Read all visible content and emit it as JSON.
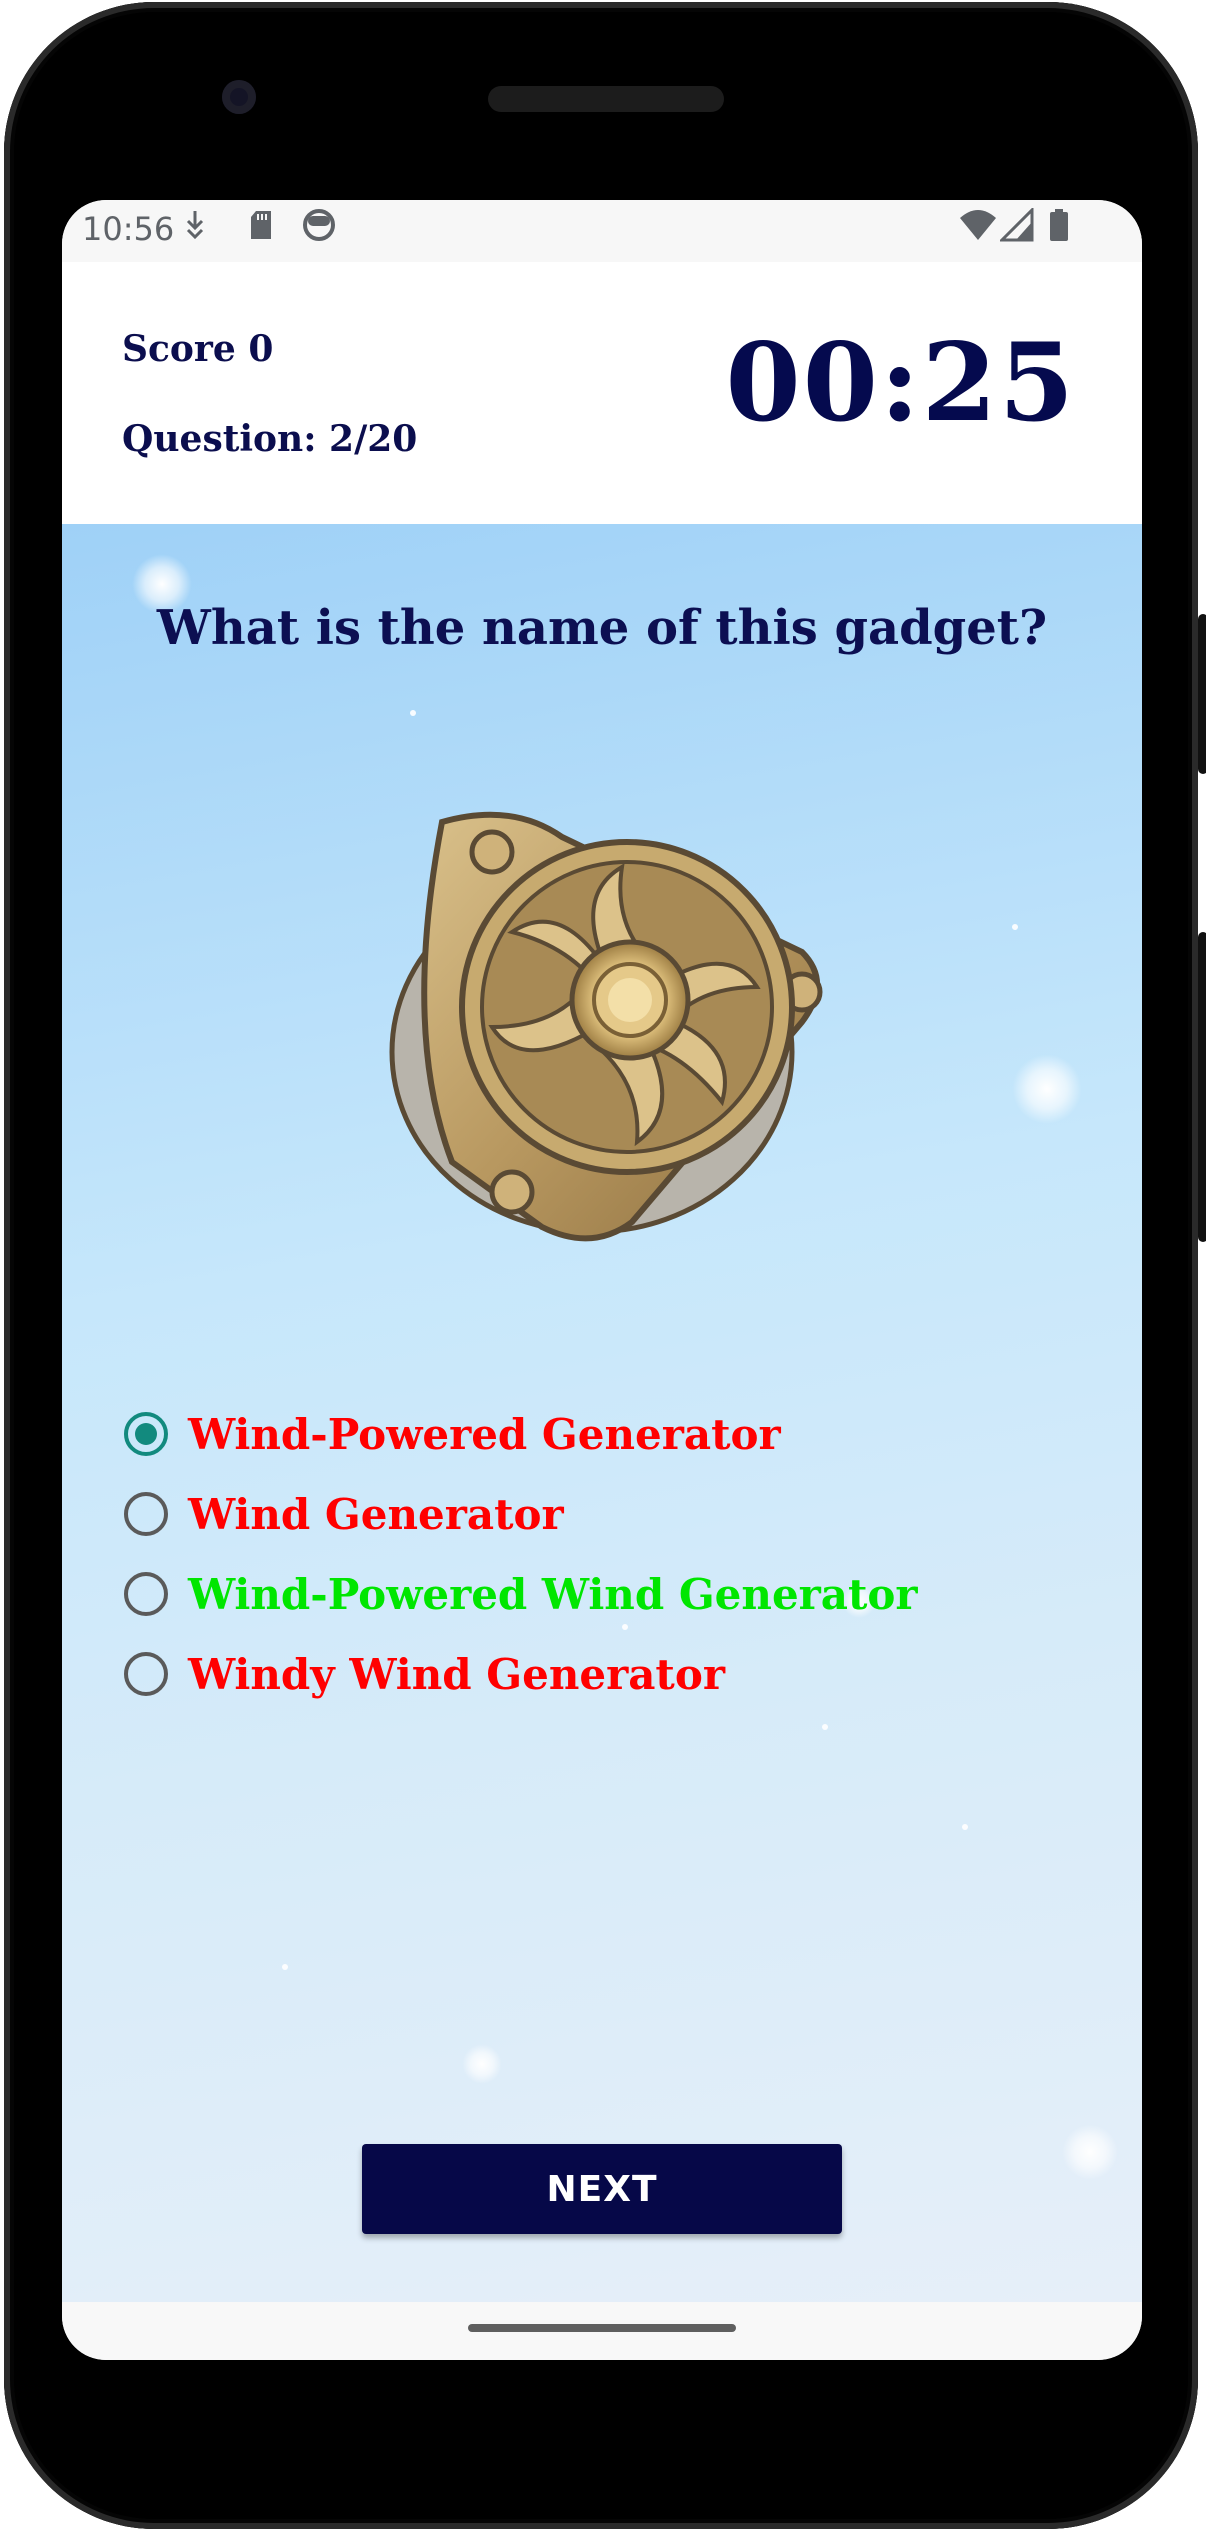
{
  "status_bar": {
    "time": "10:56",
    "icons": [
      "download-icon",
      "sd-card-icon",
      "face-icon",
      "wifi-icon",
      "signal-icon",
      "battery-icon"
    ]
  },
  "header": {
    "score_text": "Score 0",
    "question_text": "Question: 2/20",
    "timer": "00:25"
  },
  "quiz": {
    "question": "What is the name of this gadget?",
    "image_icon": "wind-generator-gadget-image",
    "options": [
      {
        "label": "Wind-Powered Generator",
        "color": "#ff0000",
        "selected": true
      },
      {
        "label": "Wind Generator",
        "color": "#ff0000",
        "selected": false
      },
      {
        "label": "Wind-Powered Wind Generator",
        "color": "#00e600",
        "selected": false
      },
      {
        "label": "Windy Wind Generator",
        "color": "#ff0000",
        "selected": false
      }
    ]
  },
  "actions": {
    "next_label": "NEXT"
  },
  "colors": {
    "primary_navy": "#060848",
    "radio_selected": "#128a7e",
    "wrong": "#ff0000",
    "correct": "#00e600"
  }
}
